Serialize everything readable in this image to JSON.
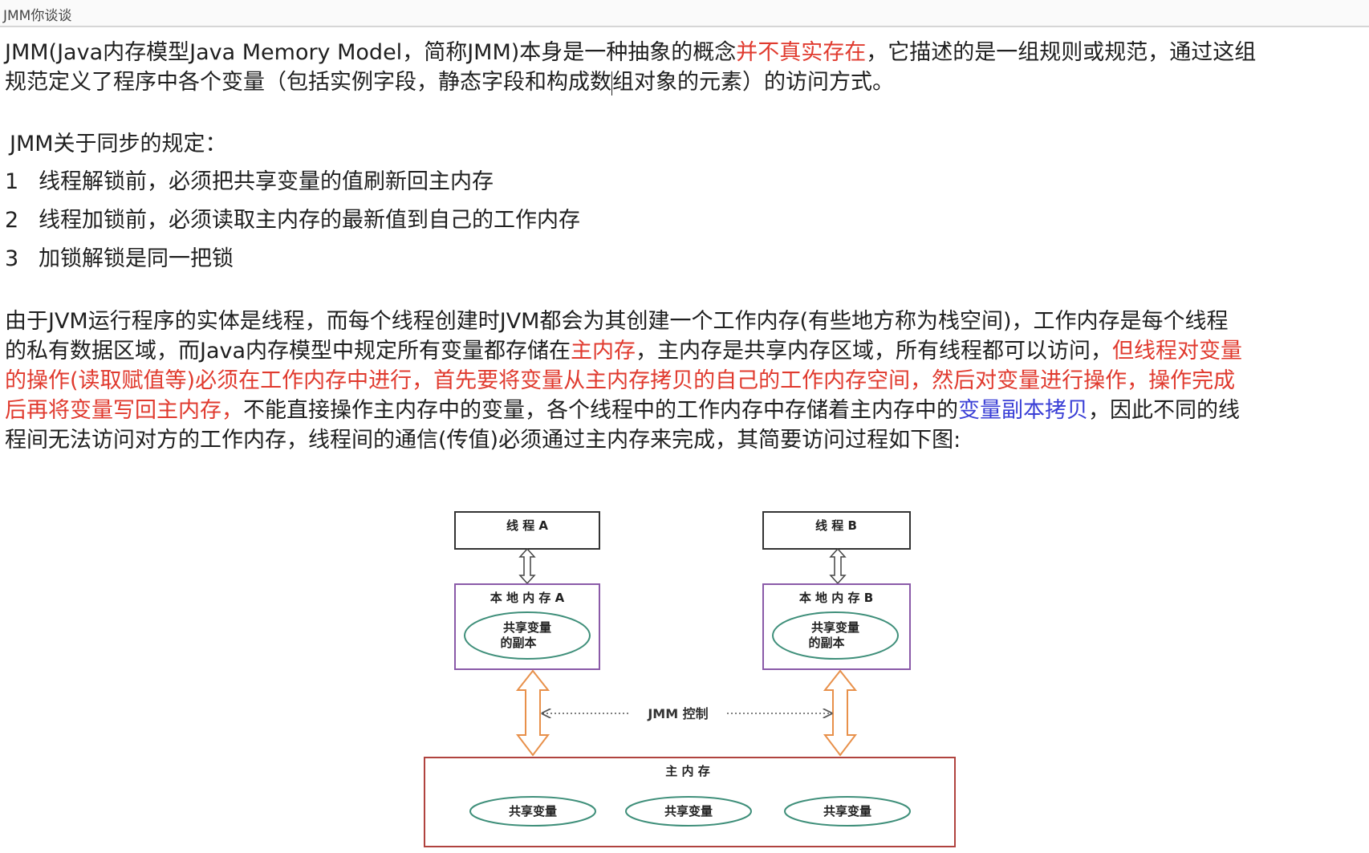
{
  "window": {
    "title": "JMM你谈谈"
  },
  "intro": {
    "line1_a": "JMM(Java内存模型Java Memory Model，简称JMM)本身是一种抽象的概念",
    "line1_red": "并不真实存在",
    "line1_b": "，它描述的是一组规则或规范，通过这组",
    "line2_a": "规范定义了程序中各个变量（包括实例字段，静态字段和构成数",
    "line2_b": "组对象的元素）的访问方式。"
  },
  "sync": {
    "heading": "JMM关于同步的规定：",
    "rules": [
      {
        "num": "1",
        "text": "线程解锁前，必须把共享变量的值刷新回主内存"
      },
      {
        "num": "2",
        "text": "线程加锁前，必须读取主内存的最新值到自己的工作内存"
      },
      {
        "num": "3",
        "text": "加锁解锁是同一把锁"
      }
    ]
  },
  "explain": {
    "l1": "由于JVM运行程序的实体是线程，而每个线程创建时JVM都会为其创建一个工作内存(有些地方称为栈空间)，工作内存是每个线程",
    "l2_a": "的私有数据区域，而Java内存模型中规定所有变量都存储在",
    "l2_red1": "主内存",
    "l2_b": "，主内存是共享内存区域，所有线程都可以访问，",
    "l2_red2": "但线程对变量",
    "l3_red": "的操作(读取赋值等)必须在工作内存中进行，首先要将变量从主内存拷贝的自己的工作内存空间，然后对变量进行操作，操作完成",
    "l4_red": "后再将变量写回主内存，",
    "l4_a": "不能直接操作主内存中的变量，各个线程中的工作内存中存储着主内存中的",
    "l4_blue": "变量副本拷贝",
    "l4_b": "，因此不同的线",
    "l5": "程间无法访问对方的工作内存，线程间的通信(传值)必须通过主内存来完成，其简要访问过程如下图:"
  },
  "diagram": {
    "thread_a": "线 程  A",
    "thread_b": "线 程  B",
    "local_a": "本 地 内 存  A",
    "local_b": "本 地 内 存  B",
    "copy_line1": "共享变量",
    "copy_line2": "的副本",
    "jmm_control": "JMM 控制",
    "main_memory": "主 内 存",
    "shared_var": "共享变量",
    "colors": {
      "thread_box": "#333333",
      "local_box": "#8a5aa8",
      "ellipse": "#3f8f7a",
      "arrow_orange": "#e8904a",
      "main_box": "#b0433f"
    }
  }
}
